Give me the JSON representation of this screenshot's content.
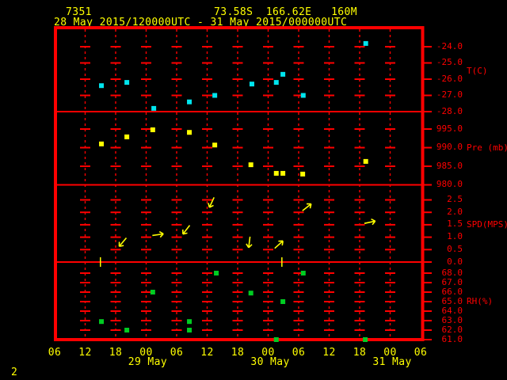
{
  "header": {
    "station_id": "7351",
    "location": "73.58S  166.62E   160M",
    "period": "28 May 2015/120000UTC - 31 May 2015/000000UTC"
  },
  "page_indicator": "2",
  "colors": {
    "frame": "#ff0000",
    "yellow_text": "#ffff00",
    "temp_point": "#00e5ee",
    "pressure_point": "#ffff00",
    "wind_arrow": "#ffff00",
    "rh_point": "#00cc22"
  },
  "x_axis": {
    "hour_labels": [
      "06",
      "12",
      "18",
      "00",
      "06",
      "12",
      "18",
      "00",
      "06",
      "12",
      "18",
      "00",
      "06"
    ],
    "hours_span": 72,
    "hours_per_division": 6,
    "date_labels": [
      {
        "label": "29 May",
        "h": 18.3
      },
      {
        "label": "30 May",
        "h": 42.4
      },
      {
        "label": "31 May",
        "h": 66.4
      }
    ]
  },
  "chart_data": [
    {
      "type": "scatter",
      "name": "temperature",
      "axis_label": "T(C)",
      "yticks": [
        -24,
        -25,
        -26,
        -27,
        -28
      ],
      "ytick_labels": [
        "-24.0",
        "-25.0",
        "-26.0",
        "-27.0",
        "-28.0"
      ],
      "ylim": [
        -28.0,
        -22.8
      ],
      "points": [
        {
          "h": 9.2,
          "v": -26.4
        },
        {
          "h": 14.2,
          "v": -26.2
        },
        {
          "h": 19.5,
          "v": -27.8
        },
        {
          "h": 26.5,
          "v": -27.4
        },
        {
          "h": 31.5,
          "v": -27.0
        },
        {
          "h": 38.8,
          "v": -26.3
        },
        {
          "h": 43.6,
          "v": -26.2
        },
        {
          "h": 44.9,
          "v": -25.7
        },
        {
          "h": 48.9,
          "v": -27.0
        },
        {
          "h": 61.2,
          "v": -23.8
        }
      ]
    },
    {
      "type": "scatter",
      "name": "pressure",
      "axis_label": "Pre (mb)",
      "yticks": [
        995,
        990,
        985,
        980
      ],
      "ytick_labels": [
        "995.0",
        "990.0",
        "985.0",
        "980.0"
      ],
      "ylim": [
        980,
        1000
      ],
      "points": [
        {
          "h": 9.2,
          "v": 991.0
        },
        {
          "h": 14.2,
          "v": 992.9
        },
        {
          "h": 19.3,
          "v": 994.8
        },
        {
          "h": 26.5,
          "v": 994.1
        },
        {
          "h": 31.5,
          "v": 990.7
        },
        {
          "h": 38.6,
          "v": 985.4
        },
        {
          "h": 43.6,
          "v": 983.1
        },
        {
          "h": 44.9,
          "v": 983.1
        },
        {
          "h": 48.8,
          "v": 982.9
        },
        {
          "h": 61.2,
          "v": 986.3
        }
      ]
    },
    {
      "type": "wind",
      "name": "wind-speed",
      "axis_label": "SPD(MPS)",
      "yticks": [
        2.5,
        2.0,
        1.5,
        1.0,
        0.5,
        0.0
      ],
      "ytick_labels": [
        "2.5",
        "2.0",
        "1.5",
        "1.0",
        "0.5",
        "0.0"
      ],
      "ylim": [
        0,
        3.1
      ],
      "points": [
        {
          "h": 13.4,
          "v": 0.8,
          "dir_deg": 130
        },
        {
          "h": 20.3,
          "v": 1.1,
          "dir_deg": -8
        },
        {
          "h": 25.9,
          "v": 1.3,
          "dir_deg": 128
        },
        {
          "h": 30.9,
          "v": 2.4,
          "dir_deg": 115
        },
        {
          "h": 38.3,
          "v": 0.8,
          "dir_deg": 97
        },
        {
          "h": 44.1,
          "v": 0.7,
          "dir_deg": -42
        },
        {
          "h": 49.6,
          "v": 2.2,
          "dir_deg": -38
        },
        {
          "h": 62.0,
          "v": 1.6,
          "dir_deg": -12
        }
      ],
      "calm_markers": [
        {
          "h": 9.0,
          "v": 0.0
        },
        {
          "h": 44.7,
          "v": 0.0
        }
      ]
    },
    {
      "type": "scatter",
      "name": "relative-humidity",
      "axis_label": "RH(%)",
      "yticks": [
        68,
        67,
        66,
        65,
        64,
        63,
        62,
        61
      ],
      "ytick_labels": [
        "68.0",
        "67.0",
        "66.0",
        "65.0",
        "64.0",
        "63.0",
        "62.0",
        "61.0"
      ],
      "ylim": [
        61,
        69.2
      ],
      "points": [
        {
          "h": 9.2,
          "v": 62.9
        },
        {
          "h": 14.2,
          "v": 62.0
        },
        {
          "h": 19.3,
          "v": 66.0
        },
        {
          "h": 26.5,
          "v": 62.9
        },
        {
          "h": 26.5,
          "v": 62.0
        },
        {
          "h": 31.8,
          "v": 68.0
        },
        {
          "h": 38.6,
          "v": 65.9
        },
        {
          "h": 43.6,
          "v": 61.0
        },
        {
          "h": 44.9,
          "v": 65.0
        },
        {
          "h": 48.9,
          "v": 68.0
        },
        {
          "h": 61.1,
          "v": 61.0
        }
      ]
    }
  ]
}
